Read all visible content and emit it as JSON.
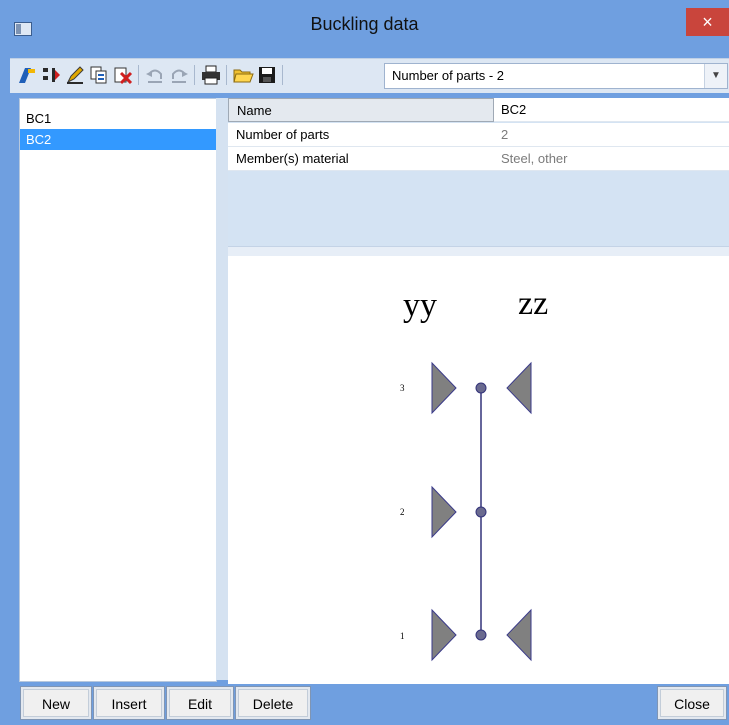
{
  "window": {
    "title": "Buckling data",
    "close_glyph": "×"
  },
  "toolbar": {
    "icons": [
      "new-item-icon",
      "move-icon",
      "edit-pencil-icon",
      "copy-icon",
      "delete-icon",
      "undo-icon",
      "redo-icon",
      "print-icon",
      "open-folder-icon",
      "save-disk-icon"
    ],
    "combo_value": "Number of parts - 2",
    "combo_arrow": "▼"
  },
  "list": {
    "items": [
      "BC1",
      "BC2"
    ],
    "selected": "BC2"
  },
  "properties": {
    "rows": [
      {
        "name": "Name",
        "value": "BC2"
      },
      {
        "name": "Number of parts",
        "value": "2"
      },
      {
        "name": "Member(s) material",
        "value": "Steel, other"
      }
    ]
  },
  "diagram": {
    "labels": {
      "yy": "yy",
      "zz": "zz"
    },
    "nodes": [
      {
        "label": "3",
        "yy_support": true,
        "zz_support": true
      },
      {
        "label": "2",
        "yy_support": true,
        "zz_support": false
      },
      {
        "label": "1",
        "yy_support": true,
        "zz_support": true
      }
    ],
    "colors": {
      "support_fill": "#808080",
      "support_stroke": "#3a3a8a",
      "member": "#33337a",
      "node": "#6a6a8f"
    }
  },
  "buttons": {
    "new": "New",
    "insert": "Insert",
    "edit": "Edit",
    "delete": "Delete",
    "close": "Close"
  }
}
